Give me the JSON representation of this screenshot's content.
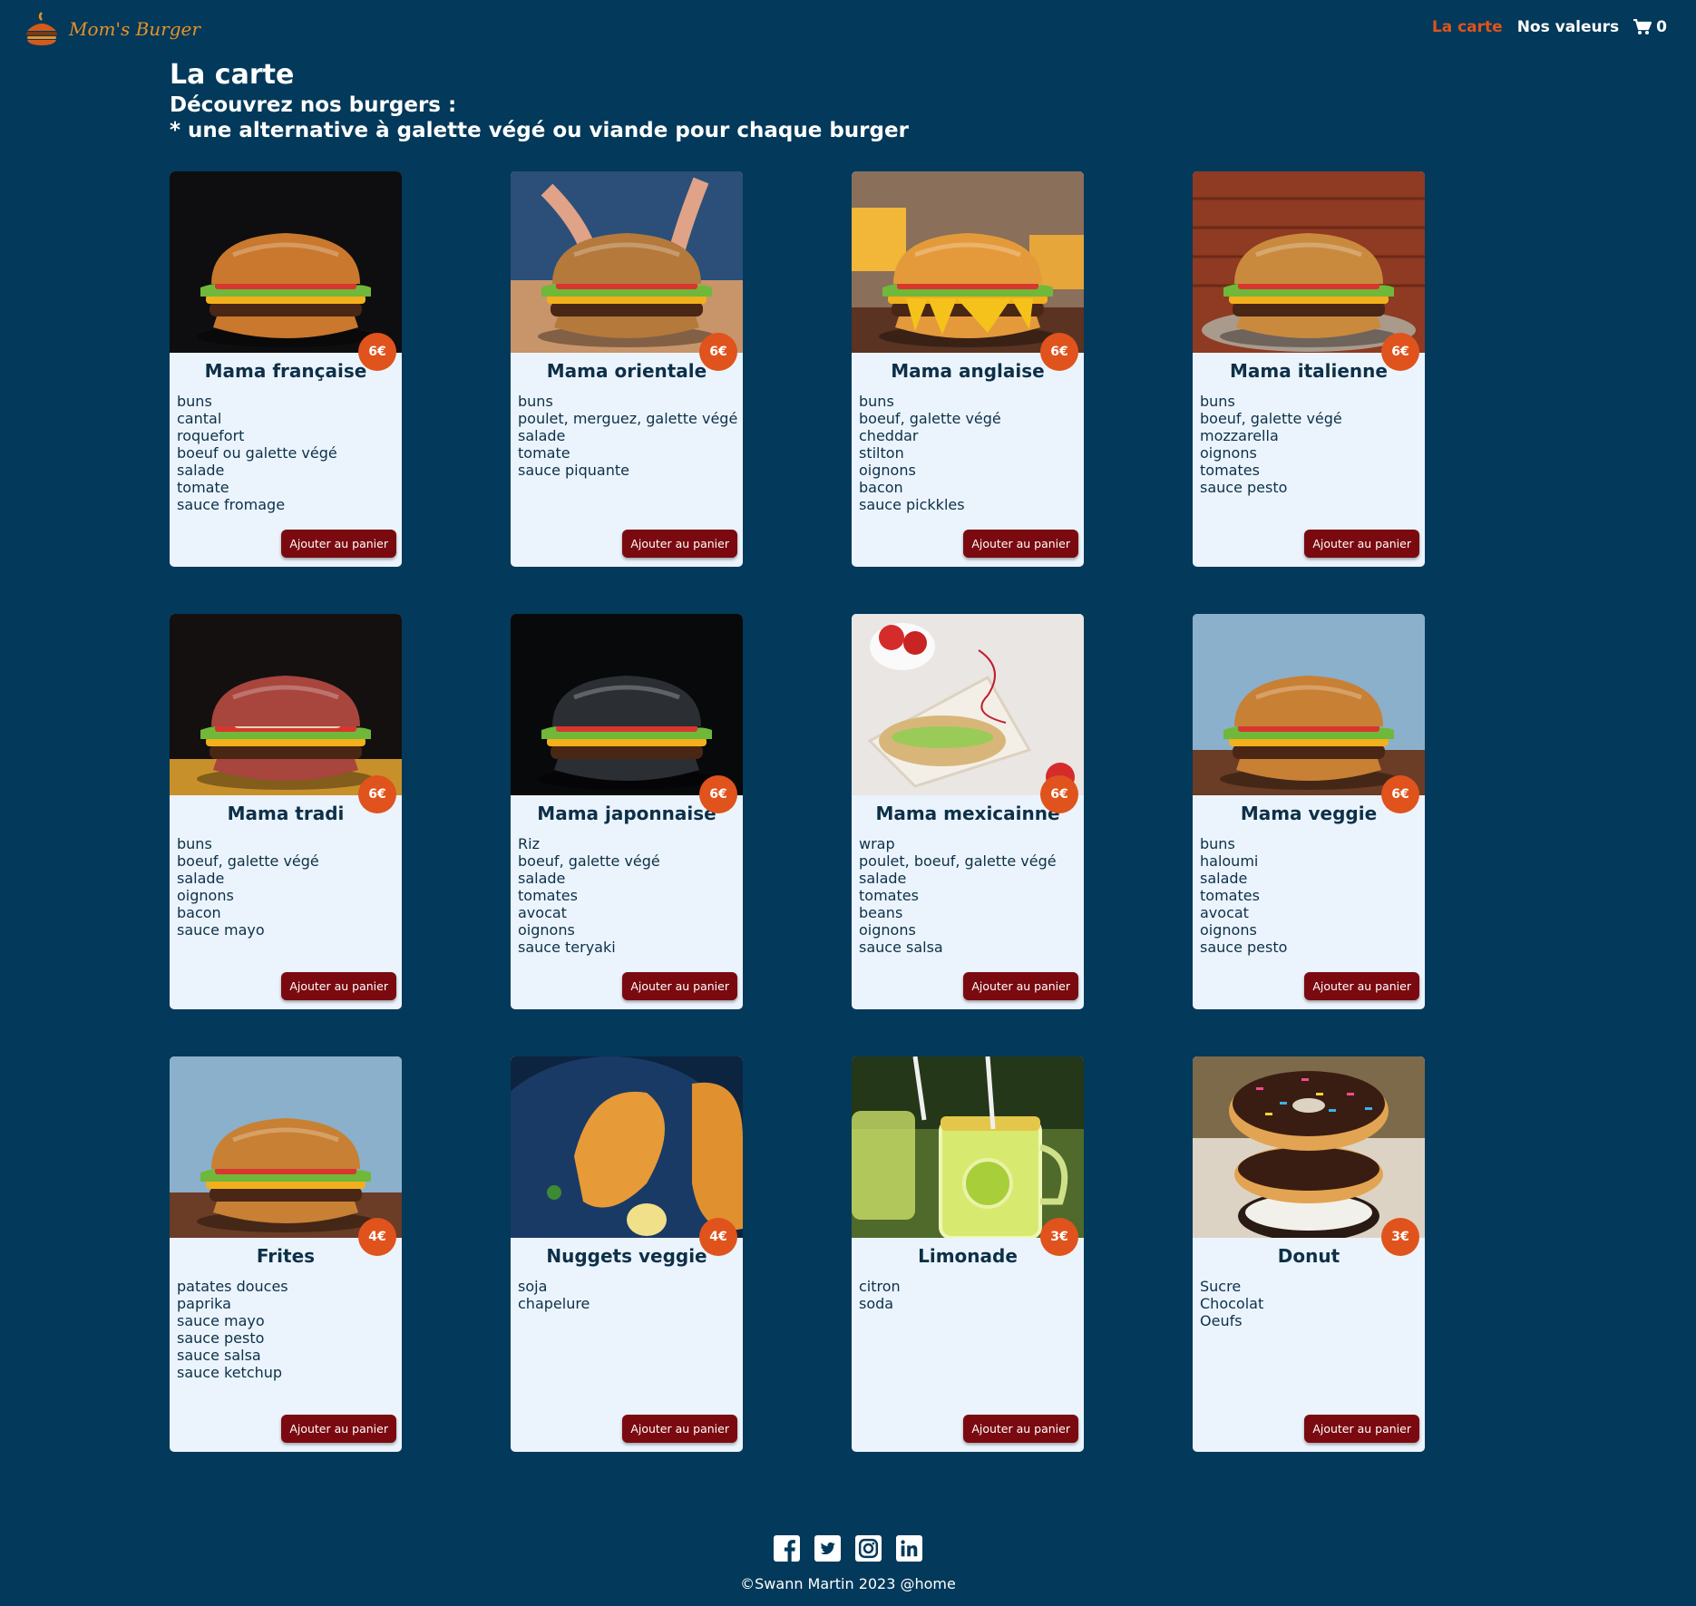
{
  "header": {
    "logo_text": "Mom's Burger",
    "nav": [
      {
        "label": "La carte",
        "active": true
      },
      {
        "label": "Nos valeurs",
        "active": false
      }
    ],
    "cart_count": "0",
    "active_color": "#e0531c"
  },
  "intro": {
    "title": "La carte",
    "subtitle_line1": "Découvrez nos burgers :",
    "subtitle_line2": "* une alternative à galette végé ou viande pour chaque burger"
  },
  "add_label": "Ajouter au panier",
  "products": [
    {
      "name": "Mama française",
      "price": "6€",
      "image": "burger-dark-bg",
      "ingredients": [
        "buns",
        "cantal",
        "roquefort",
        "boeuf ou galette végé",
        "salade",
        "tomate",
        "sauce fromage"
      ]
    },
    {
      "name": "Mama orientale",
      "price": "6€",
      "image": "burger-held",
      "ingredients": [
        "buns",
        "poulet, merguez, galette végé",
        "salade",
        "tomate",
        "sauce piquante"
      ]
    },
    {
      "name": "Mama anglaise",
      "price": "6€",
      "image": "burger-cheesy",
      "ingredients": [
        "buns",
        "boeuf, galette végé",
        "cheddar",
        "stilton",
        "oignons",
        "bacon",
        "sauce pickkles"
      ]
    },
    {
      "name": "Mama italienne",
      "price": "6€",
      "image": "burger-brick-wall",
      "ingredients": [
        "buns",
        "boeuf, galette végé",
        "mozzarella",
        "oignons",
        "tomates",
        "sauce pesto"
      ]
    },
    {
      "name": "Mama tradi",
      "price": "6€",
      "image": "burger-red-bun",
      "ingredients": [
        "buns",
        "boeuf, galette végé",
        "salade",
        "oignons",
        "bacon",
        "sauce mayo"
      ]
    },
    {
      "name": "Mama japonnaise",
      "price": "6€",
      "image": "burger-black-bun",
      "ingredients": [
        "Riz",
        "boeuf, galette végé",
        "salade",
        "tomates",
        "avocat",
        "oignons",
        "sauce teryaki"
      ]
    },
    {
      "name": "Mama mexicainne",
      "price": "6€",
      "image": "wrap-strawberries",
      "ingredients": [
        "wrap",
        "poulet, boeuf, galette végé",
        "salade",
        "tomates",
        "beans",
        "oignons",
        "sauce salsa"
      ]
    },
    {
      "name": "Mama veggie",
      "price": "6€",
      "image": "burger-veggie",
      "ingredients": [
        "buns",
        "haloumi",
        "salade",
        "tomates",
        "avocat",
        "oignons",
        "sauce pesto"
      ]
    },
    {
      "name": "Frites",
      "price": "4€",
      "image": "burger-veggie",
      "ingredients": [
        "patates douces",
        "paprika",
        "sauce mayo",
        "sauce pesto",
        "sauce salsa",
        "sauce ketchup"
      ]
    },
    {
      "name": "Nuggets veggie",
      "price": "4€",
      "image": "nuggets-pan",
      "ingredients": [
        "soja",
        "chapelure"
      ]
    },
    {
      "name": "Limonade",
      "price": "3€",
      "image": "lemonade-jar",
      "ingredients": [
        "citron",
        "soda"
      ]
    },
    {
      "name": "Donut",
      "price": "3€",
      "image": "donut-stack",
      "ingredients": [
        "Sucre",
        "Chocolat",
        "Oeufs"
      ]
    }
  ],
  "footer": {
    "socials": [
      "facebook-icon",
      "twitter-icon",
      "instagram-icon",
      "linkedin-icon"
    ],
    "copyright": "©Swann Martin 2023 @home"
  },
  "colors": {
    "background": "#03395a",
    "card": "#ebf4fc",
    "price_badge": "#e0531c",
    "button": "#7a0a10",
    "title_text": "#0d3048"
  }
}
